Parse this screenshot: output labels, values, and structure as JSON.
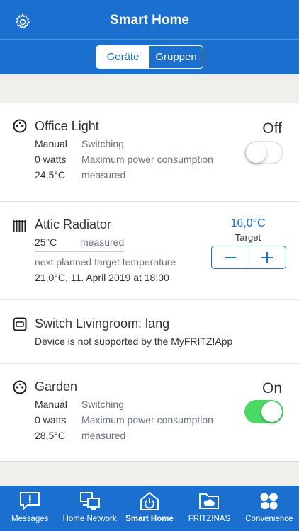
{
  "header": {
    "title": "Smart Home",
    "tabs": [
      "Geräte",
      "Gruppen"
    ]
  },
  "devices": [
    {
      "name": "Office Light",
      "mode": "Manual",
      "mode_value": "Switching",
      "power": "0 watts",
      "power_label": "Maximum power consumption",
      "temp": "24,5°C",
      "temp_label": "measured",
      "state": "Off"
    },
    {
      "name": "Attic Radiator",
      "temp": "25°C",
      "temp_label": "measured",
      "next_label": "next planned target temperature",
      "next_value": "21,0°C, 11. April 2019 at 18:00",
      "target": "16,0°C",
      "target_label": "Target"
    },
    {
      "name": "Switch Livingroom: lang",
      "note": "Device is not supported by the MyFRITZ!App"
    },
    {
      "name": "Garden",
      "mode": "Manual",
      "mode_value": "Switching",
      "power": "0 watts",
      "power_label": "Maximum power consumption",
      "temp": "28,5°C",
      "temp_label": "measured",
      "state": "On"
    }
  ],
  "tabbar": [
    "Messages",
    "Home Network",
    "Smart Home",
    "FRITZ!NAS",
    "Convenience"
  ],
  "colors": {
    "brand": "#1b6fcf",
    "toggle_on": "#4cd964"
  }
}
